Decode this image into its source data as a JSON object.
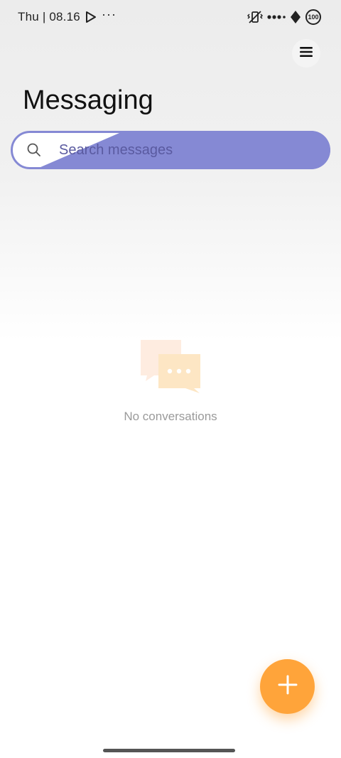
{
  "status_bar": {
    "time": "Thu | 08.16",
    "more": "···",
    "battery": "100"
  },
  "header": {
    "title": "Messaging",
    "menu_icon": "hamburger-menu-icon"
  },
  "search": {
    "placeholder": "Search messages",
    "icon": "search-icon"
  },
  "empty_state": {
    "message": "No conversations",
    "icon": "chat-bubbles-icon"
  },
  "fab": {
    "icon": "plus-icon"
  },
  "colors": {
    "accent": "#ffa43a",
    "search_highlight": "#8589d4"
  }
}
